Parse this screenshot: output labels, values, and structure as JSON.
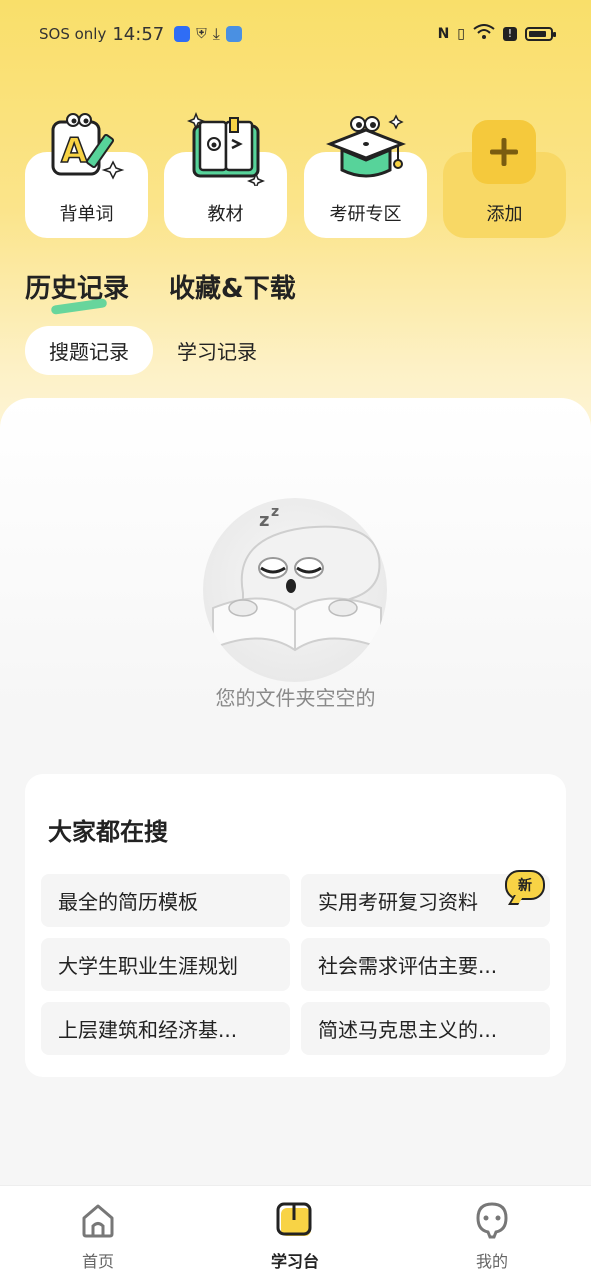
{
  "status_bar": {
    "carrier": "SOS only",
    "time": "14:57"
  },
  "tools": [
    {
      "label": "背单词",
      "icon": "vocabulary-icon"
    },
    {
      "label": "教材",
      "icon": "textbook-icon"
    },
    {
      "label": "考研专区",
      "icon": "graduate-exam-icon"
    },
    {
      "label": "添加",
      "icon": "plus-icon"
    }
  ],
  "main_tabs": [
    "历史记录",
    "收藏&下载"
  ],
  "sub_tabs": [
    "搜题记录",
    "学习记录"
  ],
  "empty_state": {
    "message": "您的文件夹空空的",
    "illustration": "sleeping-mascot"
  },
  "hot_search": {
    "title": "大家都在搜",
    "items": [
      "最全的简历模板",
      "实用考研复习资料",
      "大学生职业生涯规划",
      "社会需求评估主要...",
      "上层建筑和经济基...",
      "简述马克思主义的..."
    ],
    "badge": "新"
  },
  "bottom_nav": [
    {
      "label": "首页",
      "icon": "home-icon"
    },
    {
      "label": "学习台",
      "icon": "study-desk-icon"
    },
    {
      "label": "我的",
      "icon": "profile-icon"
    }
  ],
  "colors": {
    "accent_yellow": "#f8d865",
    "accent_green": "#57d39a"
  }
}
